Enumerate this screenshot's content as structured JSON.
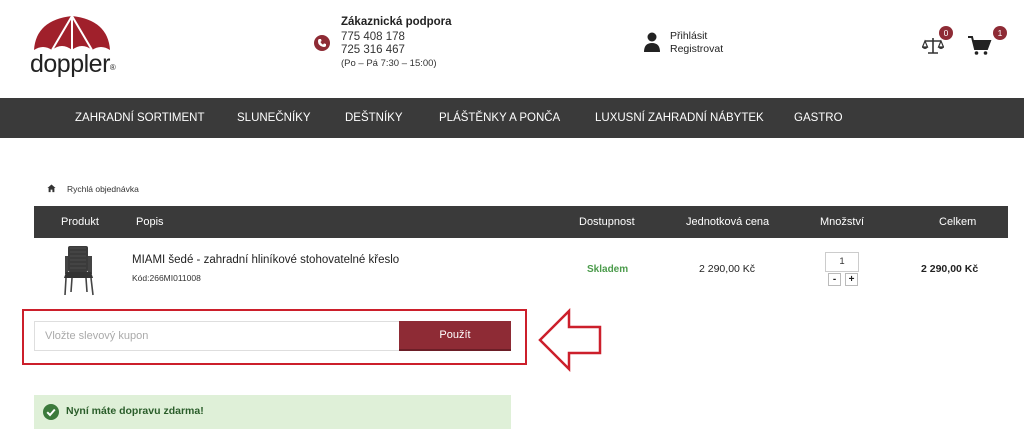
{
  "header": {
    "logo_text": "doppler",
    "logo_mark": "®",
    "support": {
      "title": "Zákaznická podpora",
      "phone1": "775 408 178",
      "phone2": "725 316 467",
      "hours": "(Po – Pá 7:30 – 15:00)"
    },
    "account": {
      "login": "Přihlásit",
      "register": "Registrovat"
    },
    "compare_count": "0",
    "cart_count": "1"
  },
  "nav": {
    "items": [
      "ZAHRADNÍ SORTIMENT",
      "SLUNEČNÍKY",
      "DEŠTNÍKY",
      "PLÁŠTĚNKY A PONČA",
      "LUXUSNÍ ZAHRADNÍ NÁBYTEK",
      "GASTRO"
    ]
  },
  "breadcrumb": {
    "current": "Rychlá objednávka"
  },
  "table": {
    "headers": [
      "Produkt",
      "Popis",
      "Dostupnost",
      "Jednotková cena",
      "Množství",
      "Celkem"
    ],
    "rows": [
      {
        "name": "MIAMI šedé - zahradní hliníkové stohovatelné křeslo",
        "code": "Kód:266MI011008",
        "availability": "Skladem",
        "unit_price": "2 290,00 Kč",
        "quantity": "1",
        "total": "2 290,00 Kč"
      }
    ]
  },
  "qty_controls": {
    "minus": "-",
    "plus": "+"
  },
  "coupon": {
    "placeholder": "Vložte slevový kupon",
    "button": "Použít"
  },
  "notice": {
    "free_shipping": "Nyní máte dopravu zdarma!"
  },
  "colors": {
    "brand": "#8e2b35",
    "nav_bg": "#3a3a3a",
    "highlight": "#cc1f2b",
    "success_bg": "#dff0d8",
    "stock": "#4b9b4b"
  },
  "icons": [
    "umbrella-logo-icon",
    "phone-icon",
    "user-icon",
    "scales-icon",
    "cart-icon",
    "home-icon",
    "chair-image",
    "arrow-left-icon",
    "check-circle-icon"
  ]
}
